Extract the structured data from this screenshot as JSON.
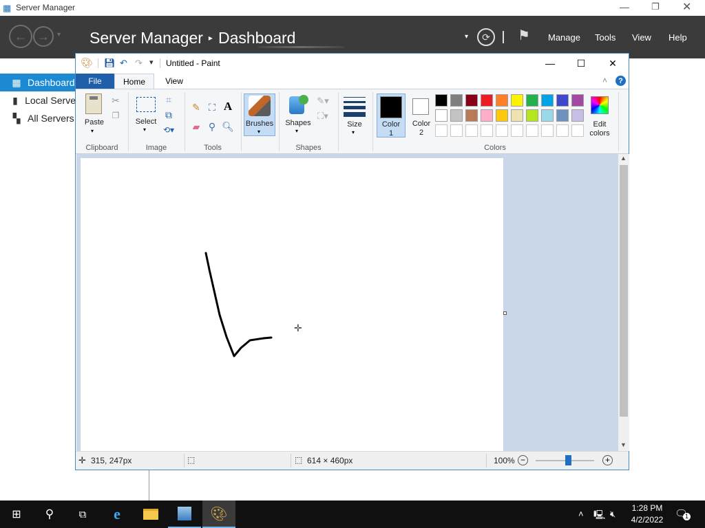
{
  "server_manager": {
    "window_title": "Server Manager",
    "heading": "Server Manager",
    "heading_sep": "▸",
    "heading_page": "Dashboard",
    "menu": [
      "Manage",
      "Tools",
      "View",
      "Help"
    ],
    "sidebar": [
      {
        "label": "Dashboard",
        "icon": "dashboard-icon",
        "selected": true
      },
      {
        "label": "Local Serve",
        "icon": "server-icon"
      },
      {
        "label": "All Servers",
        "icon": "servers-icon"
      }
    ]
  },
  "paint": {
    "title": "Untitled - Paint",
    "tabs": [
      "File",
      "Home",
      "View"
    ],
    "groups": {
      "clipboard": "Clipboard",
      "image": "Image",
      "tools": "Tools",
      "shapes": "Shapes",
      "colors": "Colors"
    },
    "buttons": {
      "paste": "Paste",
      "select": "Select",
      "brushes": "Brushes",
      "shapes": "Shapes",
      "size": "Size",
      "color1_line1": "Color",
      "color1_line2": "1",
      "color2_line1": "Color",
      "color2_line2": "2",
      "edit_colors_line1": "Edit",
      "edit_colors_line2": "colors"
    },
    "accent_color": "#1f5ea8",
    "palette_row1": [
      "#000000",
      "#7f7f7f",
      "#880015",
      "#ed1c24",
      "#ff7f27",
      "#fff200",
      "#22b14c",
      "#00a2e8",
      "#3f48cc",
      "#a349a4"
    ],
    "palette_row2": [
      "#ffffff",
      "#c3c3c3",
      "#b97a57",
      "#ffaec9",
      "#ffc90e",
      "#efe4b0",
      "#b5e61d",
      "#99d9ea",
      "#7092be",
      "#c8bfe7"
    ],
    "status": {
      "cursor_pos": "315, 247px",
      "canvas_size": "614 × 460px",
      "zoom": "100%",
      "zoom_level": 0.55
    }
  },
  "taskbar": {
    "time": "1:28 PM",
    "date": "4/2/2022",
    "notification_count": "1"
  }
}
